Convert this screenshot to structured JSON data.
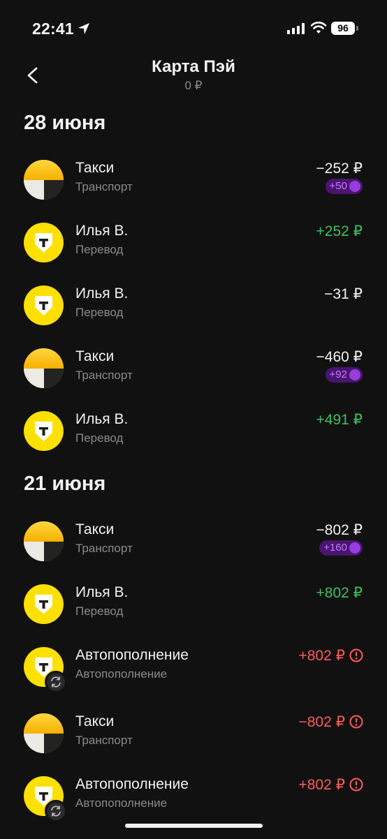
{
  "status_bar": {
    "time": "22:41",
    "battery": "96"
  },
  "header": {
    "title": "Карта Пэй",
    "balance": "0 ₽"
  },
  "groups": [
    {
      "date": "28 июня",
      "items": [
        {
          "name": "Такси",
          "category": "Транспорт",
          "amount": "−252 ₽",
          "cashback": "+50"
        },
        {
          "name": "Илья В.",
          "category": "Перевод",
          "amount": "+252 ₽"
        },
        {
          "name": "Илья В.",
          "category": "Перевод",
          "amount": "−31 ₽"
        },
        {
          "name": "Такси",
          "category": "Транспорт",
          "amount": "−460 ₽",
          "cashback": "+92"
        },
        {
          "name": "Илья В.",
          "category": "Перевод",
          "amount": "+491 ₽"
        }
      ]
    },
    {
      "date": "21 июня",
      "items": [
        {
          "name": "Такси",
          "category": "Транспорт",
          "amount": "−802 ₽",
          "cashback": "+160"
        },
        {
          "name": "Илья В.",
          "category": "Перевод",
          "amount": "+802 ₽"
        },
        {
          "name": "Автопополнение",
          "category": "Автопополнение",
          "amount": "+802 ₽"
        },
        {
          "name": "Такси",
          "category": "Транспорт",
          "amount": "−802 ₽"
        },
        {
          "name": "Автопополнение",
          "category": "Автопополнение",
          "amount": "+802 ₽"
        }
      ]
    }
  ],
  "colors": {
    "positive": "#3dc25a",
    "error": "#ff5a5a",
    "cashback_bg": "#4a1570",
    "accent": "#fce000"
  },
  "icons": {
    "back": "chevron-left-icon",
    "error": "exclamation-circle-icon",
    "sync": "sync-icon"
  }
}
